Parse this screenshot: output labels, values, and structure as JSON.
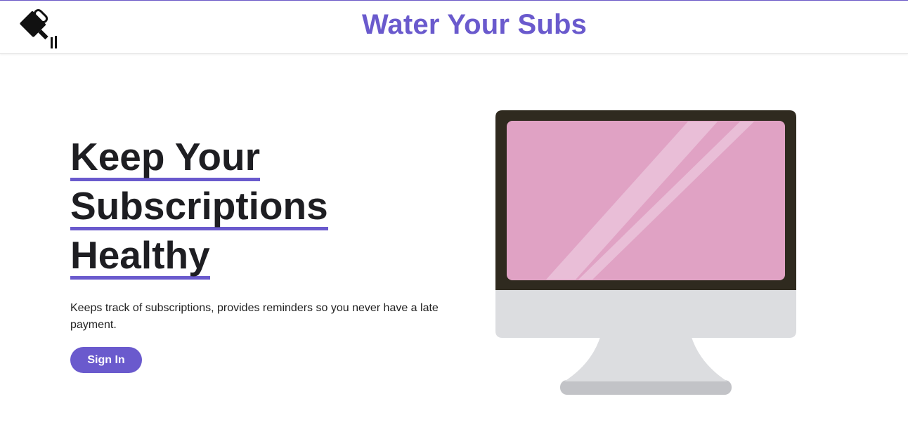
{
  "header": {
    "title": "Water Your Subs",
    "logo_icon": "watering-can-icon",
    "accent_color": "#6a5acd"
  },
  "hero": {
    "title_lines": [
      "Keep Your",
      "Subscriptions",
      "Healthy"
    ],
    "description": "Keeps track of subscriptions, provides reminders so you never have a late payment.",
    "signin_label": "Sign In"
  },
  "illustration": {
    "icon": "desktop-monitor-icon",
    "screen_color": "#e0a2c4",
    "bezel_color": "#2f2a1f",
    "stand_color": "#dcdde0"
  }
}
